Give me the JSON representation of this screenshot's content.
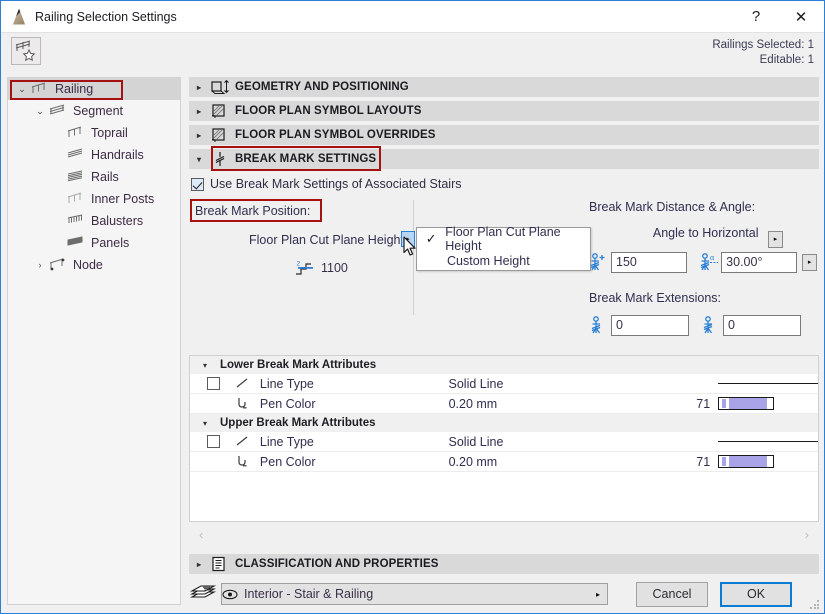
{
  "window": {
    "title": "Railing Selection Settings",
    "app_icon": "railing-app-icon",
    "help_label": "?",
    "close_label": "✕"
  },
  "toolbar": {
    "favorites_icon": "railing-favorite-icon",
    "selection_line1": "Railings Selected: 1",
    "selection_line2": "Editable: 1"
  },
  "tree": {
    "items": [
      {
        "label": "Railing",
        "icon": "railing-icon",
        "twisty": "⌄",
        "depth": 0,
        "selected": true
      },
      {
        "label": "Segment",
        "icon": "segment-icon",
        "twisty": "⌄",
        "depth": 1,
        "selected": false
      },
      {
        "label": "Toprail",
        "icon": "toprail-icon",
        "twisty": "",
        "depth": 2,
        "selected": false
      },
      {
        "label": "Handrails",
        "icon": "handrails-icon",
        "twisty": "",
        "depth": 2,
        "selected": false
      },
      {
        "label": "Rails",
        "icon": "rails-icon",
        "twisty": "",
        "depth": 2,
        "selected": false
      },
      {
        "label": "Inner Posts",
        "icon": "inner-posts-icon",
        "twisty": "",
        "depth": 2,
        "selected": false
      },
      {
        "label": "Balusters",
        "icon": "balusters-icon",
        "twisty": "",
        "depth": 2,
        "selected": false
      },
      {
        "label": "Panels",
        "icon": "panels-icon",
        "twisty": "",
        "depth": 2,
        "selected": false
      },
      {
        "label": "Node",
        "icon": "node-icon",
        "twisty": "›",
        "depth": 1,
        "selected": false
      }
    ]
  },
  "sections": [
    {
      "title": "GEOMETRY AND POSITIONING",
      "icon": "geometry-icon",
      "arrow": "▸",
      "expanded": false
    },
    {
      "title": "FLOOR PLAN SYMBOL LAYOUTS",
      "icon": "floorplan-icon",
      "arrow": "▸",
      "expanded": false
    },
    {
      "title": "FLOOR PLAN SYMBOL OVERRIDES",
      "icon": "floorplan-icon",
      "arrow": "▸",
      "expanded": false
    },
    {
      "title": "BREAK MARK SETTINGS",
      "icon": "break-mark-icon",
      "arrow": "▾",
      "expanded": true
    }
  ],
  "break_mark": {
    "use_stairs_checkbox_label": "Use Break Mark Settings of Associated Stairs",
    "use_stairs_checked": true,
    "position_label": "Break Mark Position:",
    "cut_plane_label": "Floor Plan Cut Plane Height",
    "cut_plane_value": "1100",
    "cut_plane_icon": "cut-plane-height-icon",
    "dropdown_arrow": "▸",
    "popup_options": [
      {
        "label": "Floor Plan Cut Plane Height",
        "checked": true
      },
      {
        "label": "Custom Height",
        "checked": false
      }
    ],
    "distance_angle_title": "Break Mark Distance & Angle:",
    "angle_to_horizontal_label": "Angle to Horizontal",
    "distance_value": "150",
    "distance_icon": "break-mark-distance-icon",
    "angle_value": "30.00°",
    "angle_icon": "break-mark-angle-icon",
    "extensions_title": "Break Mark Extensions:",
    "extension_lower_value": "0",
    "extension_lower_icon": "break-mark-extension-lower-icon",
    "extension_upper_value": "0",
    "extension_upper_icon": "break-mark-extension-upper-icon",
    "spinner_arrow": "▸"
  },
  "attributes": {
    "groups": [
      {
        "title": "Lower Break Mark Attributes",
        "arrow": "▾",
        "rows": [
          {
            "name": "Line Type",
            "icon": "line-type-icon",
            "has_checkbox": true,
            "checked": false,
            "value": "Solid Line",
            "number": "",
            "preview": "line"
          },
          {
            "name": "Pen Color",
            "icon": "pen-icon",
            "has_checkbox": false,
            "checked": false,
            "value": "0.20 mm",
            "number": "71",
            "preview": "swatch"
          }
        ]
      },
      {
        "title": "Upper Break Mark Attributes",
        "arrow": "▾",
        "rows": [
          {
            "name": "Line Type",
            "icon": "line-type-icon",
            "has_checkbox": true,
            "checked": false,
            "value": "Solid Line",
            "number": "",
            "preview": "line"
          },
          {
            "name": "Pen Color",
            "icon": "pen-icon",
            "has_checkbox": false,
            "checked": false,
            "value": "0.20 mm",
            "number": "71",
            "preview": "swatch"
          }
        ]
      }
    ],
    "scroll_left": "‹",
    "scroll_right": "›"
  },
  "bottom_section": {
    "title": "CLASSIFICATION AND PROPERTIES",
    "icon": "classification-icon",
    "arrow": "▸"
  },
  "footer": {
    "favorite_icon": "layers-icon",
    "layer_eye_icon": "eye-icon",
    "layer_value": "Interior - Stair & Railing",
    "layer_arrow": "▸",
    "cancel_label": "Cancel",
    "ok_label": "OK"
  },
  "colors": {
    "accent": "#0a7cd4",
    "highlight_red": "#a51010",
    "pen_swatch": "#a9a3e8",
    "section_header_bg": "#d9d9d9",
    "selected_row_bg": "#d4d4d4"
  }
}
